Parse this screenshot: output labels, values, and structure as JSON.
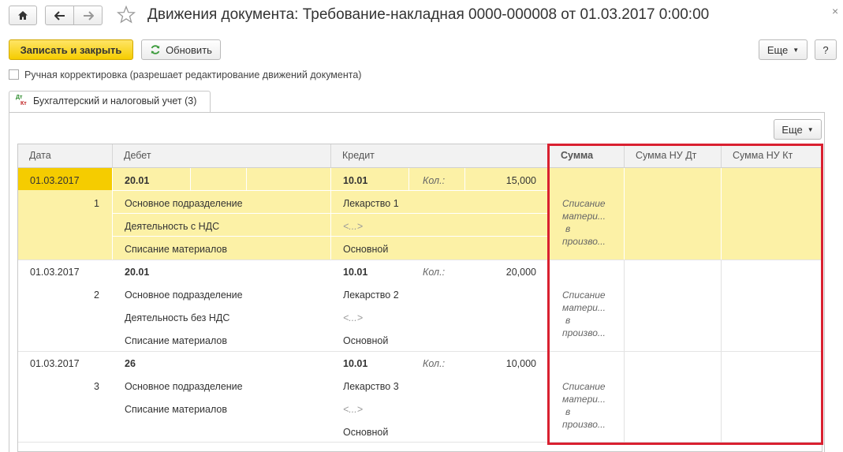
{
  "window": {
    "title": "Движения документа: Требование-накладная 0000-000008 от 01.03.2017 0:00:00",
    "close_glyph": "×"
  },
  "toolbar": {
    "save_close_label": "Записать и закрыть",
    "refresh_label": "Обновить",
    "more_label": "Еще",
    "help_label": "?"
  },
  "manual": {
    "label": "Ручная корректировка (разрешает редактирование движений документа)",
    "checked": false
  },
  "tab": {
    "label": "Бухгалтерский и налоговый учет (3)",
    "icon_top": "Дт",
    "icon_bottom": "Кт"
  },
  "table": {
    "more_label": "Еще",
    "headers": {
      "date": "Дата",
      "debit": "Дебет",
      "credit": "Кредит",
      "sum": "Сумма",
      "sum_nu_dt": "Сумма НУ Дт",
      "sum_nu_kt": "Сумма НУ Кт"
    },
    "rows": [
      {
        "date": "01.03.2017",
        "num": "1",
        "debit_account": "20.01",
        "debit_sub": [
          "Основное подразделение",
          "Деятельность с НДС",
          "Списание материалов"
        ],
        "credit_account": "10.01",
        "qty_label": "Кол.:",
        "qty": "15,000",
        "credit_sub": [
          "Лекарство 1",
          "<...>",
          "Основной"
        ],
        "sum_text": [
          "Списание",
          "матери...",
          "в",
          "произво..."
        ]
      },
      {
        "date": "01.03.2017",
        "num": "2",
        "debit_account": "20.01",
        "debit_sub": [
          "Основное подразделение",
          "Деятельность без НДС",
          "Списание материалов"
        ],
        "credit_account": "10.01",
        "qty_label": "Кол.:",
        "qty": "20,000",
        "credit_sub": [
          "Лекарство 2",
          "<...>",
          "Основной"
        ],
        "sum_text": [
          "Списание",
          "матери...",
          "в",
          "произво..."
        ]
      },
      {
        "date": "01.03.2017",
        "num": "3",
        "debit_account": "26",
        "debit_sub": [
          "Основное подразделение",
          "Списание материалов"
        ],
        "credit_account": "10.01",
        "qty_label": "Кол.:",
        "qty": "10,000",
        "credit_sub": [
          "Лекарство 3",
          "<...>",
          "Основной"
        ],
        "sum_text": [
          "Списание",
          "матери...",
          "в",
          "произво..."
        ]
      }
    ]
  },
  "colors": {
    "selected_row": "#fcf1a6",
    "selected_cell": "#f5cc00",
    "highlight_border": "#d92030",
    "accent_button": "#f5cc00"
  }
}
